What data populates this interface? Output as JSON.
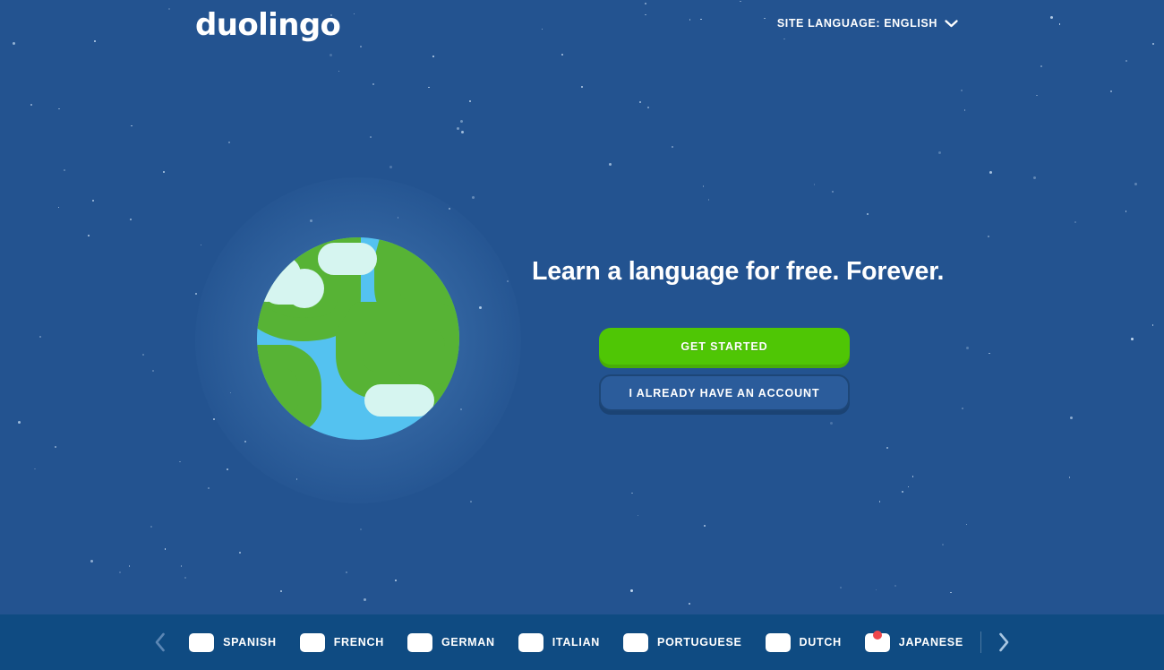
{
  "brand": {
    "logo_text": "duolingo",
    "background_color": "#235390",
    "accent_green": "#4fc605",
    "lang_bar_color": "#0f4b82"
  },
  "header": {
    "site_language": {
      "label": "SITE LANGUAGE: ENGLISH",
      "chevron_icon": "chevron-down-icon"
    }
  },
  "hero": {
    "headline": "Learn a language for free. Forever.",
    "globe_icon": "globe-illustration",
    "buttons": {
      "primary": "GET STARTED",
      "secondary": "I ALREADY HAVE AN ACCOUNT"
    }
  },
  "language_bar": {
    "prev_icon": "chevron-left-icon",
    "next_icon": "chevron-right-icon",
    "languages": [
      {
        "label": "SPANISH",
        "flag": "flag-spain"
      },
      {
        "label": "FRENCH",
        "flag": "flag-france"
      },
      {
        "label": "GERMAN",
        "flag": "flag-germany"
      },
      {
        "label": "ITALIAN",
        "flag": "flag-italy"
      },
      {
        "label": "PORTUGUESE",
        "flag": "flag-brazil"
      },
      {
        "label": "DUTCH",
        "flag": "flag-netherlands"
      },
      {
        "label": "JAPANESE",
        "flag": "flag-japan"
      }
    ]
  }
}
